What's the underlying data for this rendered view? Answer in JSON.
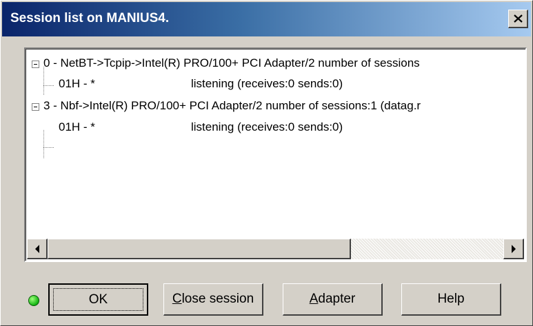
{
  "window": {
    "title": "Session list on MANIUS4.",
    "close_icon": "close-x-icon"
  },
  "tree": {
    "nodes": [
      {
        "label": "0 - NetBT->Tcpip->Intel(R) PRO/100+ PCI Adapter/2 number of sessions",
        "expanded": true,
        "children": [
          {
            "name": "01H - *",
            "status": "listening (receives:0 sends:0)"
          }
        ]
      },
      {
        "label": "3 - Nbf->Intel(R) PRO/100+ PCI Adapter/2 number of sessions:1 (datag.r",
        "expanded": true,
        "children": [
          {
            "name": "01H - *",
            "status": "listening (receives:0 sends:0)"
          }
        ]
      }
    ]
  },
  "status_indicator": {
    "icon": "green-led-icon",
    "color": "#12b312"
  },
  "buttons": {
    "ok": "OK",
    "close_session": {
      "accel": "C",
      "rest": "lose session"
    },
    "adapter": {
      "accel": "A",
      "rest": "dapter"
    },
    "help": "Help"
  }
}
